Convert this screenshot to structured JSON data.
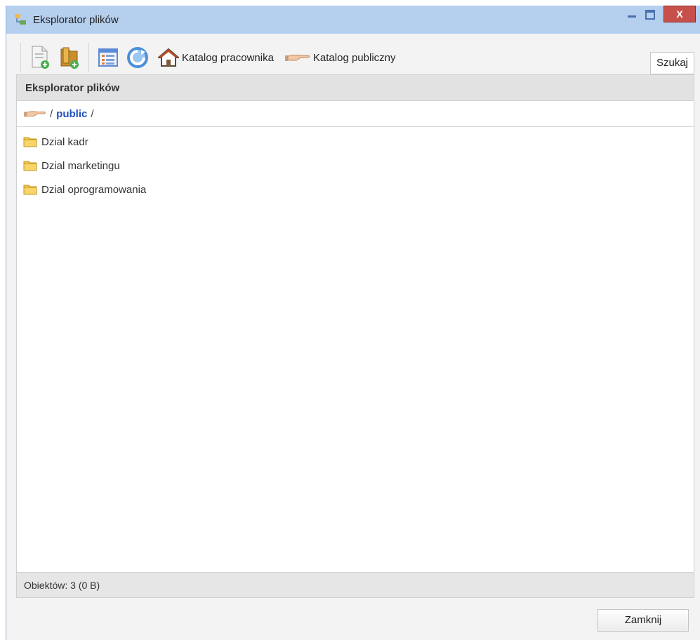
{
  "window": {
    "title": "Eksplorator plików",
    "close_glyph": "X"
  },
  "toolbar": {
    "icons": [
      "new-file-icon",
      "new-folder-icon",
      "list-view-icon",
      "refresh-icon"
    ],
    "home_label": "Katalog pracownika",
    "public_label": "Katalog publiczny",
    "search_label": "Szukaj"
  },
  "panel": {
    "header": "Eksplorator plików",
    "breadcrumb": {
      "sep": "/",
      "current": "public"
    },
    "files": [
      {
        "name": "Dzial kadr",
        "icon": "folder-icon"
      },
      {
        "name": "Dzial marketingu",
        "icon": "folder-icon"
      },
      {
        "name": "Dzial oprogramowania",
        "icon": "folder-icon"
      }
    ],
    "status": "Obiektów: 3 (0 B)"
  },
  "footer": {
    "close_label": "Zamknij"
  },
  "colors": {
    "titlebar": "#b5cfee",
    "close": "#c7504b",
    "link": "#1f4fbf",
    "folder": "#f2c94c"
  }
}
